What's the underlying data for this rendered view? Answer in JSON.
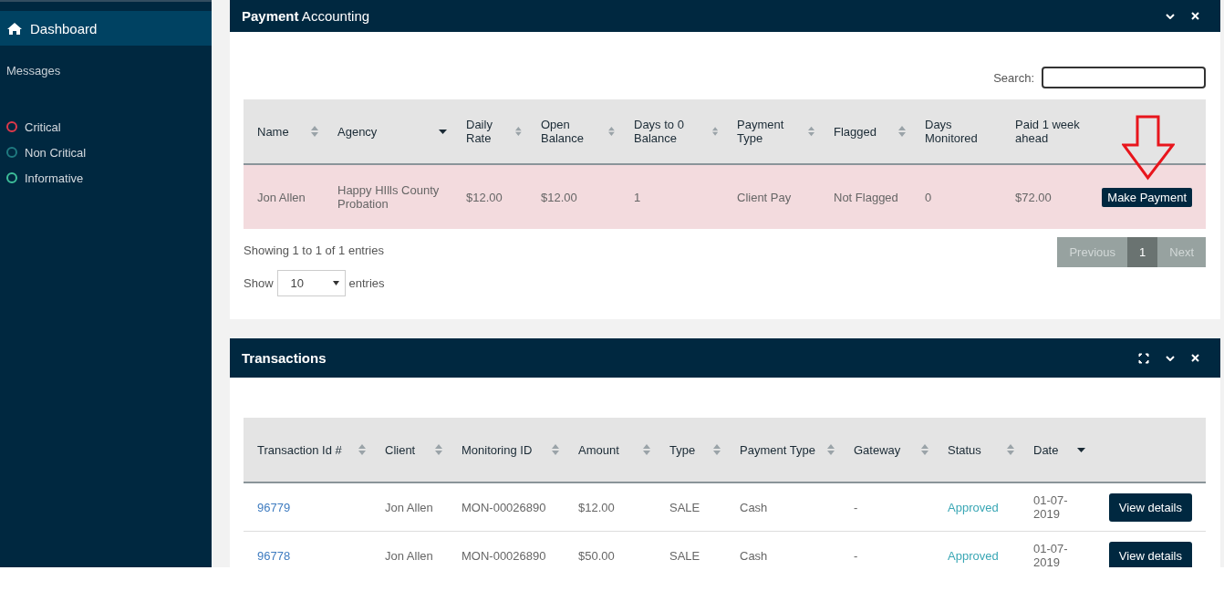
{
  "sidebar": {
    "nav": [
      {
        "label": "Dashboard",
        "selected": true
      }
    ],
    "messages_heading": "Messages",
    "legend": [
      {
        "label": "Critical",
        "color": "#e0394a"
      },
      {
        "label": "Non Critical",
        "color": "#1f7a80"
      },
      {
        "label": "Informative",
        "color": "#3dbf9a"
      }
    ]
  },
  "panels": [
    {
      "title": "**Payment** Accounting",
      "header_buttons": [
        {
          "kind": "collapse"
        },
        {
          "kind": "close"
        }
      ],
      "search": {
        "label": "Search:"
      },
      "table": {
        "columns": [
          {
            "label": "Name",
            "sortable": true,
            "sorted_descending": false
          },
          {
            "label": "Agency",
            "sortable": true,
            "sorted_descending": true
          },
          {
            "label": "Daily Rate",
            "sortable": true,
            "sorted_descending": false
          },
          {
            "label": "Open Balance",
            "sortable": true,
            "sorted_descending": false
          },
          {
            "label": "Days to 0 Balance",
            "sortable": true,
            "sorted_descending": false
          },
          {
            "label": "Payment Type",
            "sortable": true,
            "sorted_descending": false
          },
          {
            "label": "Flagged",
            "sortable": true,
            "sorted_descending": false
          },
          {
            "label": "Days Monitored",
            "sortable": false
          },
          {
            "label": "Paid 1 week ahead",
            "sortable": false
          }
        ],
        "rows": [
          {
            "highlighted": true,
            "cells": [
              "Jon Allen",
              "Happy HIlls County Probation",
              "$12.00",
              "$12.00",
              "1",
              "Client Pay",
              "Not Flagged",
              "0",
              "$72.00"
            ],
            "action": "Make Payment",
            "annotated": true
          }
        ]
      },
      "info": "Showing 1 to 1 of 1 entries",
      "pagination": [
        {
          "label": "Previous",
          "selected": false,
          "disabled": true
        },
        {
          "label": "1",
          "selected": true,
          "disabled": false
        },
        {
          "label": "Next",
          "selected": false,
          "disabled": true
        }
      ],
      "length": {
        "before": "Show",
        "value": "10",
        "after": "entries"
      }
    },
    {
      "title": "**Transactions**",
      "header_buttons": [
        {
          "kind": "expand"
        },
        {
          "kind": "collapse"
        },
        {
          "kind": "close"
        }
      ],
      "table": {
        "columns": [
          {
            "label": "Transaction Id #",
            "sortable": true,
            "sorted_descending": false
          },
          {
            "label": "Client",
            "sortable": true,
            "sorted_descending": false
          },
          {
            "label": "Monitoring ID",
            "sortable": true,
            "sorted_descending": false
          },
          {
            "label": "Amount",
            "sortable": true,
            "sorted_descending": false
          },
          {
            "label": "Type",
            "sortable": true,
            "sorted_descending": false
          },
          {
            "label": "Payment Type",
            "sortable": true,
            "sorted_descending": false
          },
          {
            "label": "Gateway",
            "sortable": true,
            "sorted_descending": false
          },
          {
            "label": "Status",
            "sortable": true,
            "sorted_descending": false
          },
          {
            "label": "Date",
            "sortable": true,
            "sorted_descending": true
          }
        ],
        "rows": [
          {
            "highlighted": false,
            "cells": [
              "96779",
              "Jon Allen",
              "MON-00026890",
              "$12.00",
              "SALE",
              "Cash",
              "-",
              "Approved",
              "01-07-2019"
            ],
            "action": "View details",
            "annotated": false
          },
          {
            "highlighted": false,
            "cells": [
              "96778",
              "Jon Allen",
              "MON-00026890",
              "$50.00",
              "SALE",
              "Cash",
              "-",
              "Approved",
              "01-07-2019"
            ],
            "action": "View details",
            "annotated": false
          }
        ]
      }
    }
  ]
}
